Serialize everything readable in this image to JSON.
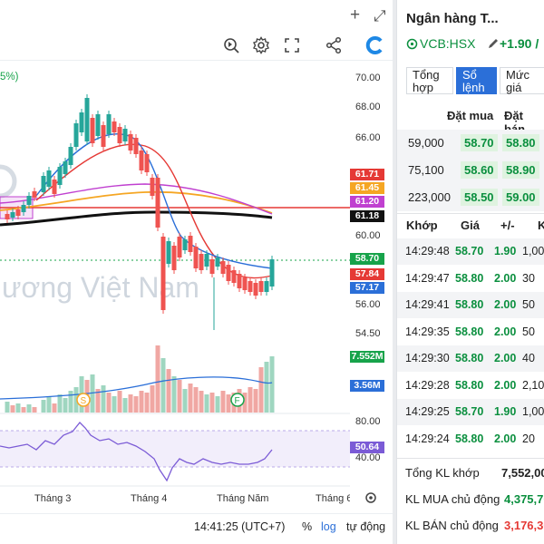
{
  "window": {
    "add_label": "+",
    "expand_label": "⤢"
  },
  "chart": {
    "legend_partial": "5%)",
    "watermark": "ương Việt Nam",
    "y_axis_ticks": [
      "70.00",
      "68.00",
      "66.00",
      "60.00",
      "56.00",
      "54.50"
    ],
    "price_tags": [
      {
        "value": "61.71",
        "color": "#e53935"
      },
      {
        "value": "61.45",
        "color": "#f5a623"
      },
      {
        "value": "61.20",
        "color": "#c040d0"
      },
      {
        "value": "61.18",
        "color": "#111111"
      },
      {
        "value": "58.70",
        "color": "#17a34a"
      },
      {
        "value": "57.84",
        "color": "#e53935"
      },
      {
        "value": "57.17",
        "color": "#2b6fd8"
      }
    ],
    "volume_tags": [
      {
        "value": "7.552M",
        "color": "#17a34a"
      },
      {
        "value": "3.56M",
        "color": "#2b6fd8"
      }
    ],
    "rsi_ticks": [
      "80.00",
      "40.00"
    ],
    "rsi_tag": {
      "value": "50.64",
      "color": "#7b5bd6"
    },
    "event_markers": [
      "S",
      "F"
    ],
    "months": [
      "Tháng 3",
      "Tháng 4",
      "Tháng Năm",
      "Tháng 6"
    ],
    "colors": {
      "up": "#26a69a",
      "down": "#ef5350",
      "ma_black": "#111111",
      "ma_orange": "#f5a623",
      "ma_purple": "#c040d0",
      "ma_red": "#e53935",
      "ma_blue": "#2b6fd8",
      "rsi": "#7b5bd6"
    }
  },
  "footer": {
    "time": "14:41:25 (UTC+7)",
    "percent": "%",
    "log": "log",
    "auto": "tự động"
  },
  "side": {
    "title": "Ngân hàng T...",
    "ticker": "VCB:HSX",
    "change": "+1.90 /",
    "tabs": [
      "Tổng hợp",
      "Sổ lệnh",
      "Mức giá"
    ],
    "active_tab": "Sổ lệnh",
    "orderbook_headers": {
      "bid": "Đặt mua",
      "ask": "Đặt bán"
    },
    "orderbook": [
      {
        "vol": "59,000",
        "bid": "58.70",
        "ask": "58.80"
      },
      {
        "vol": "75,100",
        "bid": "58.60",
        "ask": "58.90"
      },
      {
        "vol": "223,000",
        "bid": "58.50",
        "ask": "59.00"
      }
    ],
    "trades_headers": {
      "time": "Khớp",
      "price": "Giá",
      "change": "+/-",
      "vol": "K"
    },
    "trades": [
      {
        "time": "14:29:48",
        "price": "58.70",
        "change": "1.90",
        "vol": "1,00"
      },
      {
        "time": "14:29:47",
        "price": "58.80",
        "change": "2.00",
        "vol": "30"
      },
      {
        "time": "14:29:41",
        "price": "58.80",
        "change": "2.00",
        "vol": "50"
      },
      {
        "time": "14:29:35",
        "price": "58.80",
        "change": "2.00",
        "vol": "50"
      },
      {
        "time": "14:29:30",
        "price": "58.80",
        "change": "2.00",
        "vol": "40"
      },
      {
        "time": "14:29:28",
        "price": "58.80",
        "change": "2.00",
        "vol": "2,10"
      },
      {
        "time": "14:29:25",
        "price": "58.70",
        "change": "1.90",
        "vol": "1,00"
      },
      {
        "time": "14:29:24",
        "price": "58.80",
        "change": "2.00",
        "vol": "20"
      }
    ],
    "summary": [
      {
        "label": "Tổng KL khớp",
        "value": "7,552,00",
        "color": "#222222"
      },
      {
        "label": "KL MUA chủ động",
        "value": "4,375,70",
        "color": "#0a8f3e"
      },
      {
        "label": "KL BÁN chủ động",
        "value": "3,176,30",
        "color": "#e53935"
      }
    ]
  }
}
